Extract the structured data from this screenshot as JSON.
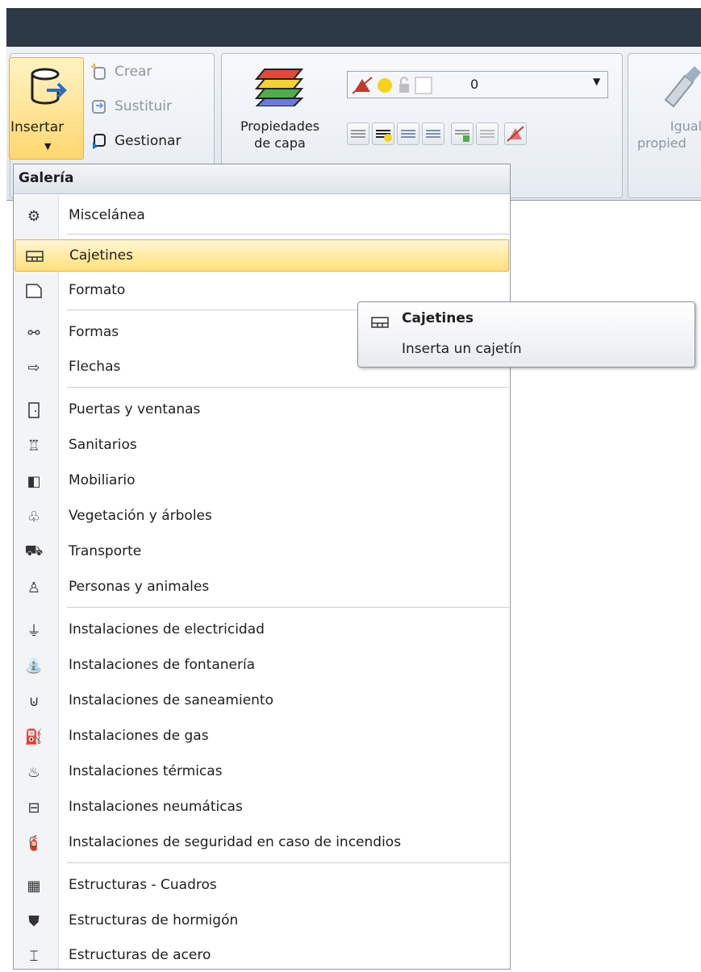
{
  "ribbon": {
    "insert_label": "Insertar",
    "crear_label": "Crear",
    "sustituir_label": "Sustituir",
    "gestionar_label": "Gestionar",
    "layer_props_label_1": "Propiedades",
    "layer_props_label_2": "de capa",
    "layer_combo_value": "0",
    "match_props_label_1": "Igual",
    "match_props_label_2": "propied"
  },
  "menu": {
    "header": "Galería",
    "items": [
      {
        "label": "Miscelánea",
        "icon": "gear-icon"
      },
      {
        "label": "Cajetines",
        "icon": "title-block-icon"
      },
      {
        "label": "Formato",
        "icon": "sheet-icon"
      },
      {
        "label": "Formas",
        "icon": "shapes-icon"
      },
      {
        "label": "Flechas",
        "icon": "arrow-right-icon"
      },
      {
        "label": "Puertas y ventanas",
        "icon": "door-icon"
      },
      {
        "label": "Sanitarios",
        "icon": "toilet-icon"
      },
      {
        "label": "Mobiliario",
        "icon": "furniture-icon"
      },
      {
        "label": "Vegetación y árboles",
        "icon": "tree-icon"
      },
      {
        "label": "Transporte",
        "icon": "car-icon"
      },
      {
        "label": "Personas y animales",
        "icon": "person-icon"
      },
      {
        "label": "Instalaciones de electricidad",
        "icon": "plug-icon"
      },
      {
        "label": "Instalaciones de fontanería",
        "icon": "tap-icon"
      },
      {
        "label": "Instalaciones de saneamiento",
        "icon": "pipe-icon"
      },
      {
        "label": "Instalaciones de gas",
        "icon": "gas-icon"
      },
      {
        "label": "Instalaciones térmicas",
        "icon": "heater-icon"
      },
      {
        "label": "Instalaciones neumáticas",
        "icon": "compressor-icon"
      },
      {
        "label": "Instalaciones de seguridad en caso de incendios",
        "icon": "extinguisher-icon"
      },
      {
        "label": "Estructuras - Cuadros",
        "icon": "grid-table-icon"
      },
      {
        "label": "Estructuras de hormigón",
        "icon": "concrete-icon"
      },
      {
        "label": "Estructuras de acero",
        "icon": "steel-beam-icon"
      }
    ]
  },
  "tooltip": {
    "title": "Cajetines",
    "description": "Inserta un cajetín"
  },
  "colors": {
    "highlight": "#ffe07a",
    "titlebar": "#2c3846"
  }
}
